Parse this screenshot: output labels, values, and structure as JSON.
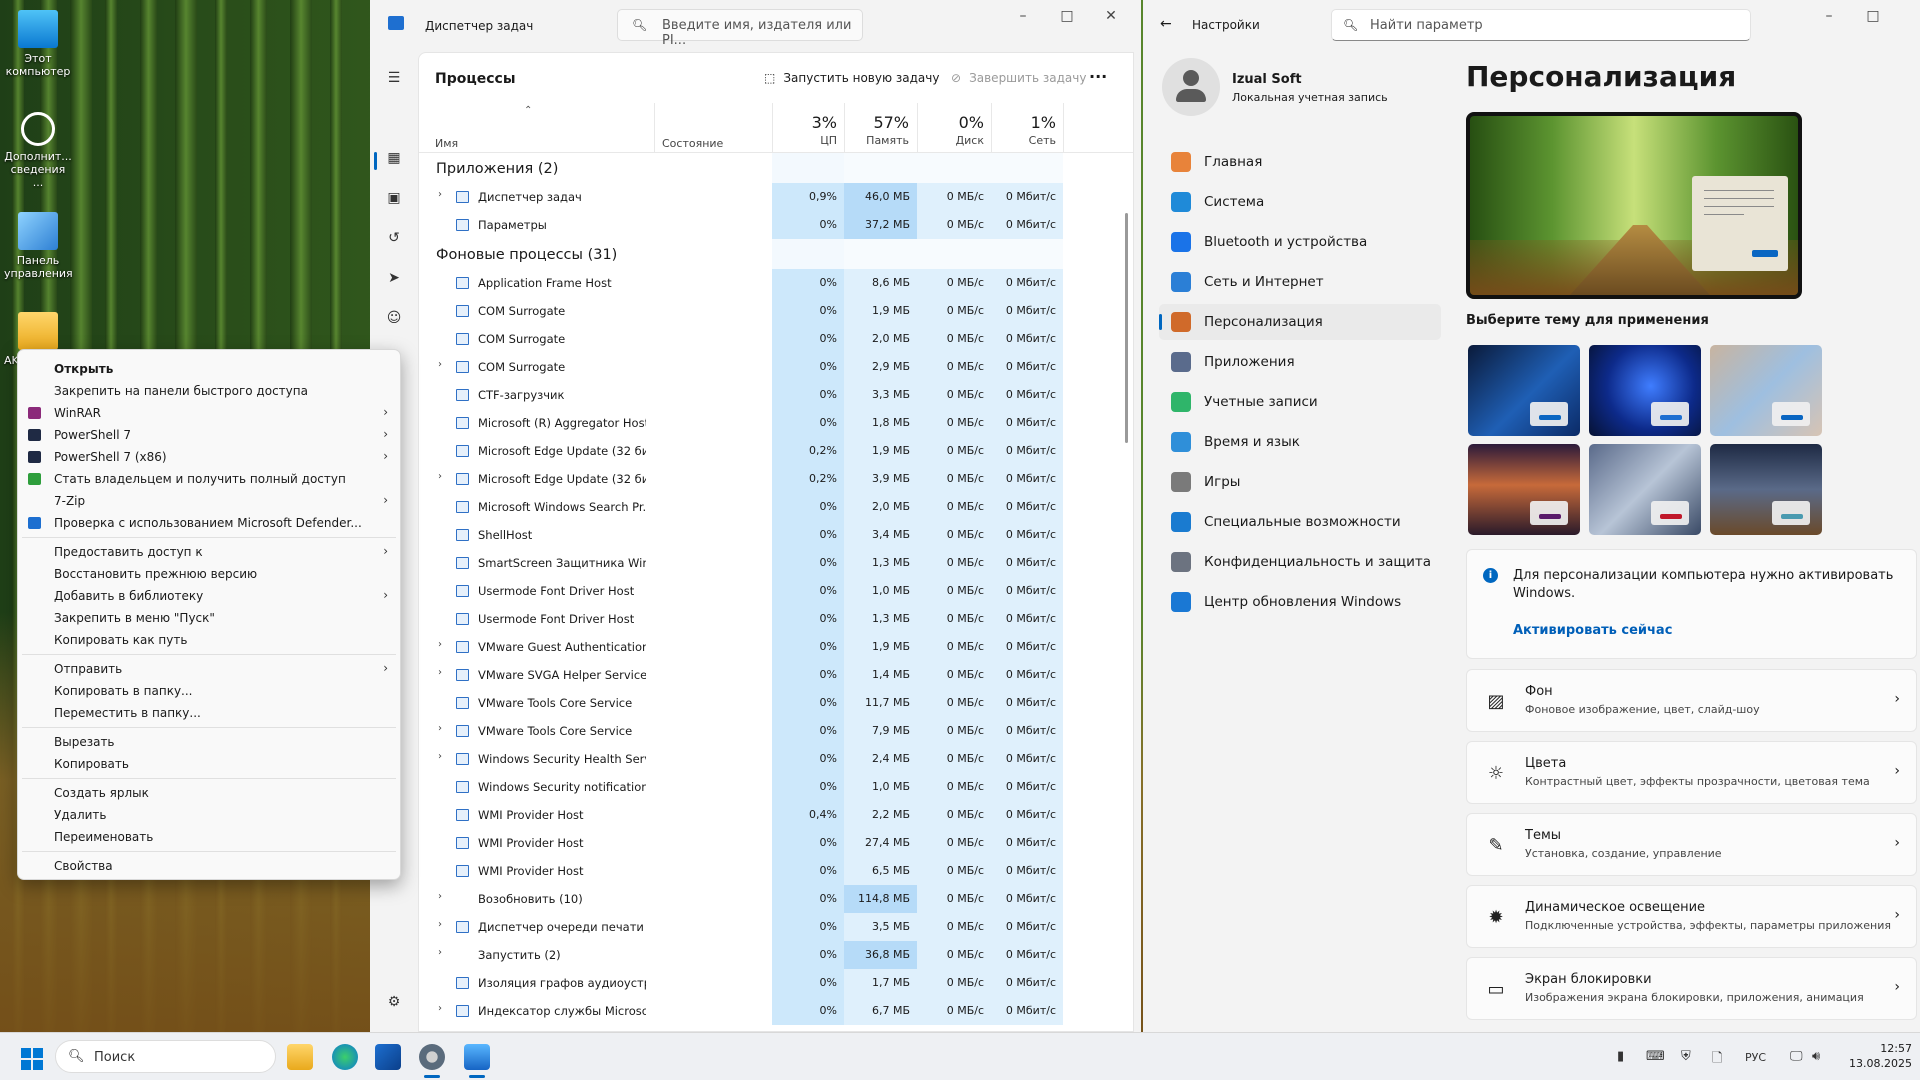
{
  "desktop": {
    "icons": [
      {
        "label": "Этот компьютер"
      },
      {
        "label": "Дополнит... сведения ..."
      },
      {
        "label": "Панель управления"
      },
      {
        "label": "AK"
      }
    ]
  },
  "taskmanager": {
    "title": "Диспетчер задач",
    "search_placeholder": "Введите имя, издателя или PI...",
    "page_title": "Процессы",
    "run_task": "Запустить новую задачу",
    "end_task": "Завершить задачу",
    "more": "···",
    "columns": {
      "name": "Имя",
      "status": "Состояние",
      "cpu_pct": "3%",
      "cpu": "ЦП",
      "mem_pct": "57%",
      "mem": "Память",
      "disk_pct": "0%",
      "disk": "Диск",
      "net_pct": "1%",
      "net": "Сеть"
    },
    "apps_section": "Приложения (2)",
    "apps": [
      {
        "name": "Диспетчер задач",
        "cpu": "0,9%",
        "mem": "46,0 МБ",
        "disk": "0 МБ/с",
        "net": "0 Мбит/с",
        "expand": true,
        "hot": true
      },
      {
        "name": "Параметры",
        "cpu": "0%",
        "mem": "37,2 МБ",
        "disk": "0 МБ/с",
        "net": "0 Мбит/с",
        "expand": false,
        "hot": true
      }
    ],
    "bg_section": "Фоновые процессы (31)",
    "bg": [
      {
        "name": "Application Frame Host",
        "cpu": "0%",
        "mem": "8,6 МБ",
        "disk": "0 МБ/с",
        "net": "0 Мбит/с",
        "expand": false
      },
      {
        "name": "COM Surrogate",
        "cpu": "0%",
        "mem": "1,9 МБ",
        "disk": "0 МБ/с",
        "net": "0 Мбит/с",
        "expand": false
      },
      {
        "name": "COM Surrogate",
        "cpu": "0%",
        "mem": "2,0 МБ",
        "disk": "0 МБ/с",
        "net": "0 Мбит/с",
        "expand": false
      },
      {
        "name": "COM Surrogate",
        "cpu": "0%",
        "mem": "2,9 МБ",
        "disk": "0 МБ/с",
        "net": "0 Мбит/с",
        "expand": true
      },
      {
        "name": "CTF-загрузчик",
        "cpu": "0%",
        "mem": "3,3 МБ",
        "disk": "0 МБ/с",
        "net": "0 Мбит/с",
        "expand": false
      },
      {
        "name": "Microsoft (R) Aggregator Host",
        "cpu": "0%",
        "mem": "1,8 МБ",
        "disk": "0 МБ/с",
        "net": "0 Мбит/с",
        "expand": false
      },
      {
        "name": "Microsoft Edge Update (32 би...",
        "cpu": "0,2%",
        "mem": "1,9 МБ",
        "disk": "0 МБ/с",
        "net": "0 Мбит/с",
        "expand": false
      },
      {
        "name": "Microsoft Edge Update (32 би...",
        "cpu": "0,2%",
        "mem": "3,9 МБ",
        "disk": "0 МБ/с",
        "net": "0 Мбит/с",
        "expand": true
      },
      {
        "name": "Microsoft Windows Search Pr...",
        "cpu": "0%",
        "mem": "2,0 МБ",
        "disk": "0 МБ/с",
        "net": "0 Мбит/с",
        "expand": false
      },
      {
        "name": "ShellHost",
        "cpu": "0%",
        "mem": "3,4 МБ",
        "disk": "0 МБ/с",
        "net": "0 Мбит/с",
        "expand": false
      },
      {
        "name": "SmartScreen Защитника Win...",
        "cpu": "0%",
        "mem": "1,3 МБ",
        "disk": "0 МБ/с",
        "net": "0 Мбит/с",
        "expand": false
      },
      {
        "name": "Usermode Font Driver Host",
        "cpu": "0%",
        "mem": "1,0 МБ",
        "disk": "0 МБ/с",
        "net": "0 Мбит/с",
        "expand": false
      },
      {
        "name": "Usermode Font Driver Host",
        "cpu": "0%",
        "mem": "1,3 МБ",
        "disk": "0 МБ/с",
        "net": "0 Мбит/с",
        "expand": false
      },
      {
        "name": "VMware Guest Authentication...",
        "cpu": "0%",
        "mem": "1,9 МБ",
        "disk": "0 МБ/с",
        "net": "0 Мбит/с",
        "expand": true
      },
      {
        "name": "VMware SVGA Helper Service (...",
        "cpu": "0%",
        "mem": "1,4 МБ",
        "disk": "0 МБ/с",
        "net": "0 Мбит/с",
        "expand": true
      },
      {
        "name": "VMware Tools Core Service",
        "cpu": "0%",
        "mem": "11,7 МБ",
        "disk": "0 МБ/с",
        "net": "0 Мбит/с",
        "expand": false
      },
      {
        "name": "VMware Tools Core Service",
        "cpu": "0%",
        "mem": "7,9 МБ",
        "disk": "0 МБ/с",
        "net": "0 Мбит/с",
        "expand": true
      },
      {
        "name": "Windows Security Health Servi...",
        "cpu": "0%",
        "mem": "2,4 МБ",
        "disk": "0 МБ/с",
        "net": "0 Мбит/с",
        "expand": true
      },
      {
        "name": "Windows Security notification...",
        "cpu": "0%",
        "mem": "1,0 МБ",
        "disk": "0 МБ/с",
        "net": "0 Мбит/с",
        "expand": false
      },
      {
        "name": "WMI Provider Host",
        "cpu": "0,4%",
        "mem": "2,2 МБ",
        "disk": "0 МБ/с",
        "net": "0 Мбит/с",
        "expand": false
      },
      {
        "name": "WMI Provider Host",
        "cpu": "0%",
        "mem": "27,4 МБ",
        "disk": "0 МБ/с",
        "net": "0 Мбит/с",
        "expand": false
      },
      {
        "name": "WMI Provider Host",
        "cpu": "0%",
        "mem": "6,5 МБ",
        "disk": "0 МБ/с",
        "net": "0 Мбит/с",
        "expand": false
      },
      {
        "name": "Возобновить (10)",
        "cpu": "0%",
        "mem": "114,8 МБ",
        "disk": "0 МБ/с",
        "net": "0 Мбит/с",
        "expand": true,
        "hot": true,
        "noicon": true
      },
      {
        "name": "Диспетчер очереди печати",
        "cpu": "0%",
        "mem": "3,5 МБ",
        "disk": "0 МБ/с",
        "net": "0 Мбит/с",
        "expand": true
      },
      {
        "name": "Запустить (2)",
        "cpu": "0%",
        "mem": "36,8 МБ",
        "disk": "0 МБ/с",
        "net": "0 Мбит/с",
        "expand": true,
        "hot": true,
        "noicon": true
      },
      {
        "name": "Изоляция графов аудиоустр...",
        "cpu": "0%",
        "mem": "1,7 МБ",
        "disk": "0 МБ/с",
        "net": "0 Мбит/с",
        "expand": false
      },
      {
        "name": "Индексатор службы Microso...",
        "cpu": "0%",
        "mem": "6,7 МБ",
        "disk": "0 МБ/с",
        "net": "0 Мбит/с",
        "expand": true
      }
    ]
  },
  "context_menu": {
    "items": [
      {
        "label": "Открыть",
        "bold": true
      },
      {
        "label": "Закрепить на панели быстрого доступа"
      },
      {
        "label": "WinRAR",
        "sub": true,
        "icon": "#8b2a7a"
      },
      {
        "label": "PowerShell 7",
        "sub": true,
        "icon": "#1f2a44"
      },
      {
        "label": "PowerShell 7 (x86)",
        "sub": true,
        "icon": "#1f2a44"
      },
      {
        "label": "Стать владельцем и получить полный доступ",
        "icon": "#2e9e3c"
      },
      {
        "label": "7-Zip",
        "sub": true
      },
      {
        "label": "Проверка с использованием Microsoft Defender...",
        "icon": "#1d6fd0"
      },
      {
        "sep": true
      },
      {
        "label": "Предоставить доступ к",
        "sub": true
      },
      {
        "label": "Восстановить прежнюю версию"
      },
      {
        "label": "Добавить в библиотеку",
        "sub": true
      },
      {
        "label": "Закрепить в меню \"Пуск\""
      },
      {
        "label": "Копировать как путь"
      },
      {
        "sep": true
      },
      {
        "label": "Отправить",
        "sub": true
      },
      {
        "label": "Копировать в папку..."
      },
      {
        "label": "Переместить в папку..."
      },
      {
        "sep": true
      },
      {
        "label": "Вырезать"
      },
      {
        "label": "Копировать"
      },
      {
        "sep": true
      },
      {
        "label": "Создать ярлык"
      },
      {
        "label": "Удалить"
      },
      {
        "label": "Переименовать"
      },
      {
        "sep": true
      },
      {
        "label": "Свойства"
      }
    ]
  },
  "settings": {
    "title": "Настройки",
    "search_placeholder": "Найти параметр",
    "user_name": "Izual Soft",
    "user_type": "Локальная учетная запись",
    "nav": [
      {
        "label": "Главная",
        "color": "#e8833a"
      },
      {
        "label": "Система",
        "color": "#1f8ad8"
      },
      {
        "label": "Bluetooth и устройства",
        "color": "#1a73e8"
      },
      {
        "label": "Сеть и Интернет",
        "color": "#2b7fd6"
      },
      {
        "label": "Персонализация",
        "color": "#d06a2a",
        "active": true
      },
      {
        "label": "Приложения",
        "color": "#5a6b8c"
      },
      {
        "label": "Учетные записи",
        "color": "#2fb56a"
      },
      {
        "label": "Время и язык",
        "color": "#2f8fd9"
      },
      {
        "label": "Игры",
        "color": "#7a7a7a"
      },
      {
        "label": "Специальные возможности",
        "color": "#1a7bd0"
      },
      {
        "label": "Конфиденциальность и защита",
        "color": "#6c7380"
      },
      {
        "label": "Центр обновления Windows",
        "color": "#1a78d4"
      }
    ],
    "page_title": "Персонализация",
    "choose_theme": "Выберите тему для применения",
    "themes": [
      {
        "bg": "linear-gradient(135deg,#0a1a3a,#1f5fb5 55%,#0b2a66)",
        "btn": "#0a66c2"
      },
      {
        "bg": "radial-gradient(circle at 55% 45%,#3f7dff,#0d2a8a 55%,#061233)",
        "btn": "#1f6fd1"
      },
      {
        "bg": "linear-gradient(135deg,#c8b4a0,#9ebfe0 50%,#d7c4b4)",
        "btn": "#0a66c2"
      },
      {
        "bg": "linear-gradient(180deg,#2c1a3a,#c76a3a 45%,#2a1a2a)",
        "btn": "#5a1a6a"
      },
      {
        "bg": "linear-gradient(135deg,#5a6a8a,#b7c4d6 50%,#3a4a66)",
        "btn": "#c0182a"
      },
      {
        "bg": "linear-gradient(180deg,#1e2a44,#5a6a88 50%,#6a4a2a)",
        "btn": "#4a9ab0"
      }
    ],
    "notice_text": "Для персонализации компьютера нужно активировать Windows.",
    "notice_link": "Активировать сейчас",
    "cards": [
      {
        "title": "Фон",
        "desc": "Фоновое изображение, цвет, слайд-шоу"
      },
      {
        "title": "Цвета",
        "desc": "Контрастный цвет, эффекты прозрачности, цветовая тема"
      },
      {
        "title": "Темы",
        "desc": "Установка, создание, управление"
      },
      {
        "title": "Динамическое освещение",
        "desc": "Подключенные устройства, эффекты, параметры приложения"
      },
      {
        "title": "Экран блокировки",
        "desc": "Изображения экрана блокировки, приложения, анимация"
      }
    ]
  },
  "taskbar": {
    "search_placeholder": "Поиск",
    "lang": "РУС",
    "time": "12:57",
    "date": "13.08.2025"
  }
}
